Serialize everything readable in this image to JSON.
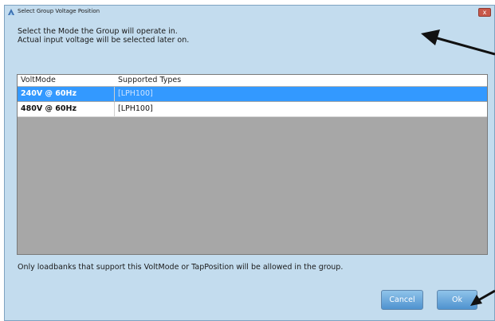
{
  "window": {
    "title": "Select Group Voltage Position",
    "close_glyph": "x"
  },
  "instructions": {
    "line1": "Select the Mode the Group will operate in.",
    "line2": "Actual input voltage will be selected later on."
  },
  "grid": {
    "columns": [
      "VoltMode",
      "Supported Types"
    ],
    "rows": [
      {
        "voltmode": "240V @ 60Hz",
        "types": "[LPH100]",
        "selected": true
      },
      {
        "voltmode": "480V @ 60Hz",
        "types": "[LPH100]",
        "selected": false
      }
    ]
  },
  "footer": {
    "note": "Only loadbanks that support this VoltMode or TapPosition will be allowed in the group."
  },
  "buttons": {
    "cancel": "Cancel",
    "ok": "Ok"
  },
  "colors": {
    "window_bg": "#c3dcee",
    "selection": "#3399ff",
    "grid_empty": "#a7a7a7",
    "close_button": "#c8584a",
    "button_blue": "#4f93cf",
    "arrow": "#111111"
  },
  "icons": {
    "app": "app-icon",
    "close": "close-icon",
    "annotation_arrow": "arrow-icon"
  }
}
